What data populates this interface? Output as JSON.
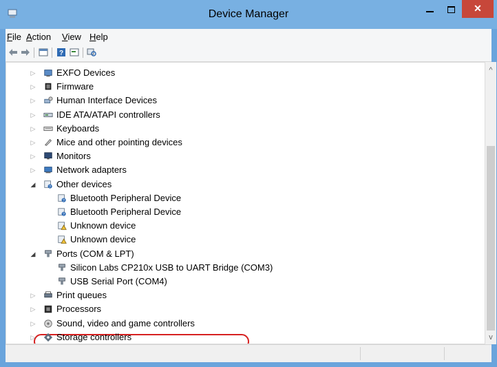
{
  "window": {
    "title": "Device Manager",
    "close_glyph": "✕"
  },
  "menu": [
    {
      "label": "File",
      "accel": "F",
      "rest": "ile"
    },
    {
      "label": "Action",
      "accel": "A",
      "rest": "ction"
    },
    {
      "label": "View",
      "accel": "V",
      "rest": "iew"
    },
    {
      "label": "Help",
      "accel": "H",
      "rest": "elp"
    }
  ],
  "toolbar": [
    "back-arrow-icon",
    "forward-arrow-icon",
    "show-hide-console-tree-icon",
    "help-icon",
    "properties-icon",
    "scan-hardware-icon"
  ],
  "tree": [
    {
      "label": "EXFO Devices",
      "level": 0,
      "expander": "collapsed",
      "icon": "device-icon"
    },
    {
      "label": "Firmware",
      "level": 0,
      "expander": "collapsed",
      "icon": "firmware-icon"
    },
    {
      "label": "Human Interface Devices",
      "level": 0,
      "expander": "collapsed",
      "icon": "hid-icon"
    },
    {
      "label": "IDE ATA/ATAPI controllers",
      "level": 0,
      "expander": "collapsed",
      "icon": "ide-controller-icon"
    },
    {
      "label": "Keyboards",
      "level": 0,
      "expander": "collapsed",
      "icon": "keyboard-icon"
    },
    {
      "label": "Mice and other pointing devices",
      "level": 0,
      "expander": "collapsed",
      "icon": "mouse-icon"
    },
    {
      "label": "Monitors",
      "level": 0,
      "expander": "collapsed",
      "icon": "monitor-icon"
    },
    {
      "label": "Network adapters",
      "level": 0,
      "expander": "collapsed",
      "icon": "network-adapter-icon"
    },
    {
      "label": "Other devices",
      "level": 0,
      "expander": "expanded",
      "icon": "unknown-device-icon"
    },
    {
      "label": "Bluetooth Peripheral Device",
      "level": 1,
      "expander": "none",
      "icon": "unknown-device-icon"
    },
    {
      "label": "Bluetooth Peripheral Device",
      "level": 1,
      "expander": "none",
      "icon": "unknown-device-icon"
    },
    {
      "label": "Unknown device",
      "level": 1,
      "expander": "none",
      "icon": "warning-device-icon"
    },
    {
      "label": "Unknown device",
      "level": 1,
      "expander": "none",
      "icon": "warning-device-icon"
    },
    {
      "label": "Ports (COM & LPT)",
      "level": 0,
      "expander": "expanded",
      "icon": "port-icon"
    },
    {
      "label": "Silicon Labs CP210x USB to UART Bridge (COM3)",
      "level": 1,
      "expander": "none",
      "icon": "port-icon"
    },
    {
      "label": "USB Serial Port (COM4)",
      "level": 1,
      "expander": "none",
      "icon": "port-icon",
      "highlighted": true
    },
    {
      "label": "Print queues",
      "level": 0,
      "expander": "collapsed",
      "icon": "printer-icon"
    },
    {
      "label": "Processors",
      "level": 0,
      "expander": "collapsed",
      "icon": "processor-icon"
    },
    {
      "label": "Sound, video and game controllers",
      "level": 0,
      "expander": "collapsed",
      "icon": "sound-icon"
    },
    {
      "label": "Storage controllers",
      "level": 0,
      "expander": "collapsed",
      "icon": "storage-icon"
    }
  ],
  "colors": {
    "titlebar": "#78b0e2",
    "close": "#c7473a",
    "highlight": "#d62020"
  }
}
